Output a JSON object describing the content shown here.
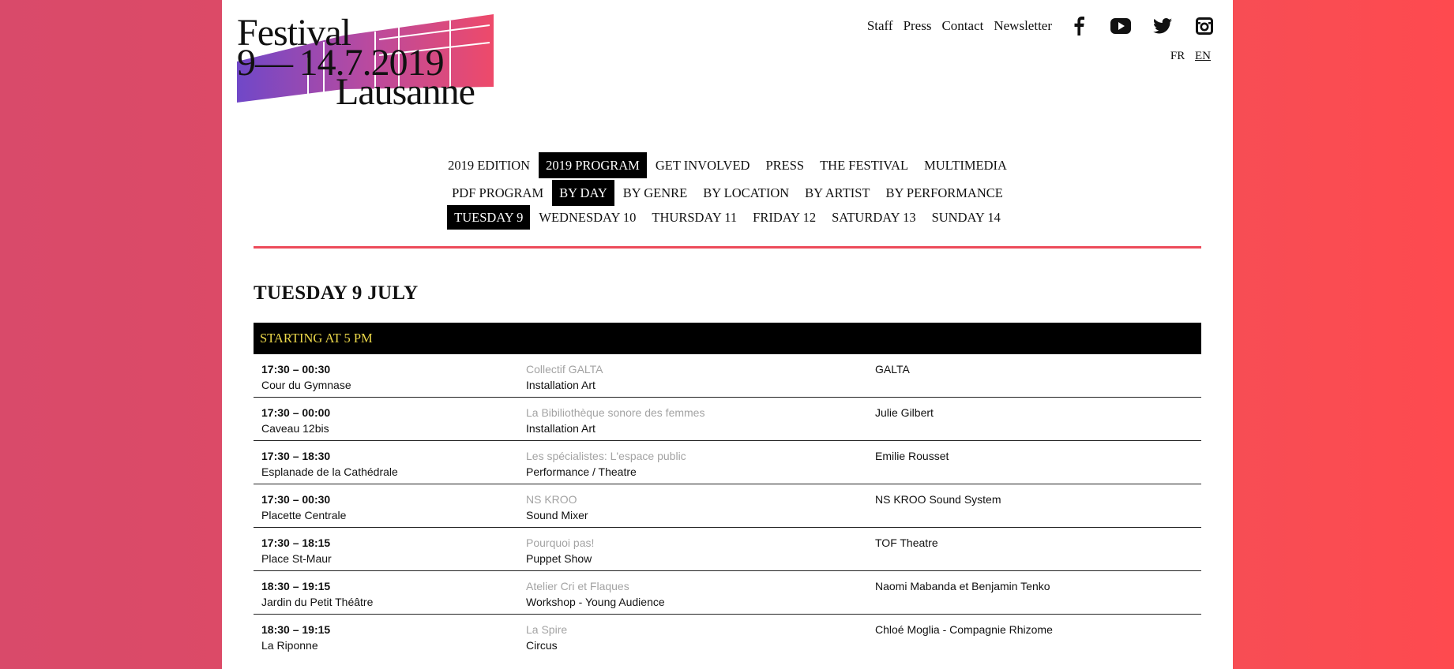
{
  "logo": {
    "line1": "Festival",
    "line2": "9— 14.7.2019",
    "line3": "Lausanne"
  },
  "topnav": [
    "Staff",
    "Press",
    "Contact",
    "Newsletter"
  ],
  "social": [
    "facebook-icon",
    "youtube-icon",
    "twitter-icon",
    "instagram-icon"
  ],
  "lang": {
    "fr": "FR",
    "en": "EN"
  },
  "nav1": [
    "2019 EDITION",
    "2019 PROGRAM",
    "GET INVOLVED",
    "PRESS",
    "THE FESTIVAL",
    "MULTIMEDIA"
  ],
  "nav2": [
    "PDF PROGRAM",
    "BY DAY",
    "BY GENRE",
    "BY LOCATION",
    "BY ARTIST",
    "BY PERFORMANCE"
  ],
  "nav3": [
    "TUESDAY 9",
    "WEDNESDAY 10",
    "THURSDAY 11",
    "FRIDAY 12",
    "SATURDAY 13",
    "SUNDAY 14"
  ],
  "day_title": "TUESDAY 9 JULY",
  "section": "STARTING AT 5 PM",
  "events": [
    {
      "time": "17:30 – 00:30",
      "place": "Cour du Gymnase",
      "title": "Collectif GALTA",
      "genre": "Installation Art",
      "artist": "GALTA"
    },
    {
      "time": "17:30 – 00:00",
      "place": "Caveau 12bis",
      "title": "La Bibiliothèque sonore des femmes",
      "genre": "Installation Art",
      "artist": "Julie Gilbert"
    },
    {
      "time": "17:30 – 18:30",
      "place": "Esplanade de la Cathédrale",
      "title": "Les spécialistes: L'espace public",
      "genre": "Performance / Theatre",
      "artist": "Emilie Rousset"
    },
    {
      "time": "17:30 – 00:30",
      "place": "Placette Centrale",
      "title": "NS KROO",
      "genre": "Sound Mixer",
      "artist": "NS KROO Sound System"
    },
    {
      "time": "17:30 – 18:15",
      "place": "Place St-Maur",
      "title": "Pourquoi pas!",
      "genre": "Puppet Show",
      "artist": "TOF Theatre"
    },
    {
      "time": "18:30 – 19:15",
      "place": "Jardin du Petit Théâtre",
      "title": "Atelier Cri et Flaques",
      "genre": "Workshop - Young Audience",
      "artist": "Naomi Mabanda et Benjamin Tenko"
    },
    {
      "time": "18:30 – 19:15",
      "place": "La Riponne",
      "title": "La Spire",
      "genre": "Circus",
      "artist": "Chloé Moglia - Compagnie Rhizome"
    }
  ]
}
